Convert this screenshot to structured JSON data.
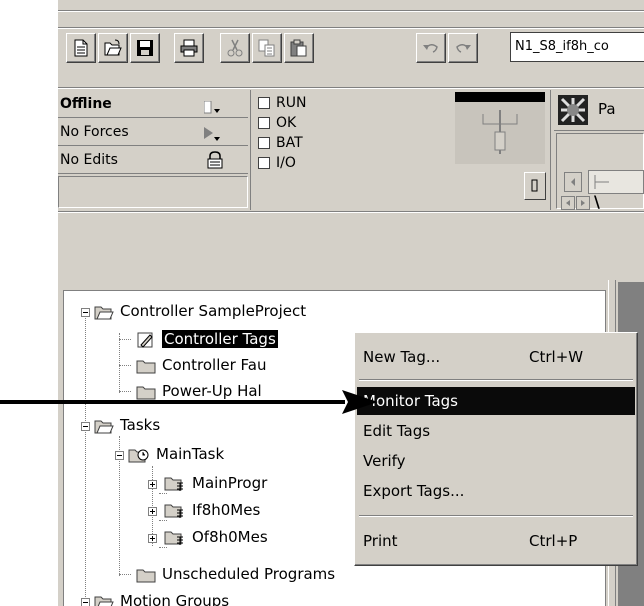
{
  "toolbar": {
    "buttons": [
      {
        "name": "new-document-icon"
      },
      {
        "name": "open-folder-icon"
      },
      {
        "name": "save-disk-icon"
      },
      {
        "name": "print-icon"
      },
      {
        "name": "cut-icon"
      },
      {
        "name": "copy-icon"
      },
      {
        "name": "paste-icon"
      },
      {
        "name": "undo-icon"
      },
      {
        "name": "redo-icon"
      }
    ],
    "project_path": "N1_S8_if8h_co"
  },
  "status": {
    "mode": "Offline",
    "forces": "No Forces",
    "edits": "No Edits",
    "indicators": [
      "RUN",
      "OK",
      "BAT",
      "I/O"
    ]
  },
  "right_panel": {
    "tab_label_fragment": "Pa",
    "nav_fragment": "\\"
  },
  "tree": {
    "items": [
      {
        "label": "Controller SampleProject"
      },
      {
        "label": "Controller Tags"
      },
      {
        "label": "Controller Fau"
      },
      {
        "label": "Power-Up Hal"
      },
      {
        "label": "Tasks"
      },
      {
        "label": "MainTask"
      },
      {
        "label": "MainProgr"
      },
      {
        "label": "If8h0Mes"
      },
      {
        "label": "Of8h0Mes"
      },
      {
        "label": "Unscheduled Programs"
      },
      {
        "label": "Motion Groups"
      }
    ]
  },
  "context_menu": {
    "items": [
      {
        "label": "New Tag...",
        "shortcut": "Ctrl+W"
      },
      {
        "label": "Monitor Tags",
        "shortcut": ""
      },
      {
        "label": "Edit Tags",
        "shortcut": ""
      },
      {
        "label": "Verify",
        "shortcut": ""
      },
      {
        "label": "Export Tags...",
        "shortcut": ""
      },
      {
        "label": "Print",
        "shortcut": "Ctrl+P"
      }
    ],
    "highlighted_index": 1
  },
  "colors": {
    "window_bg": "#d4d0c8",
    "highlight_bg": "#0a0a0a",
    "highlight_text": "#ffffff"
  }
}
